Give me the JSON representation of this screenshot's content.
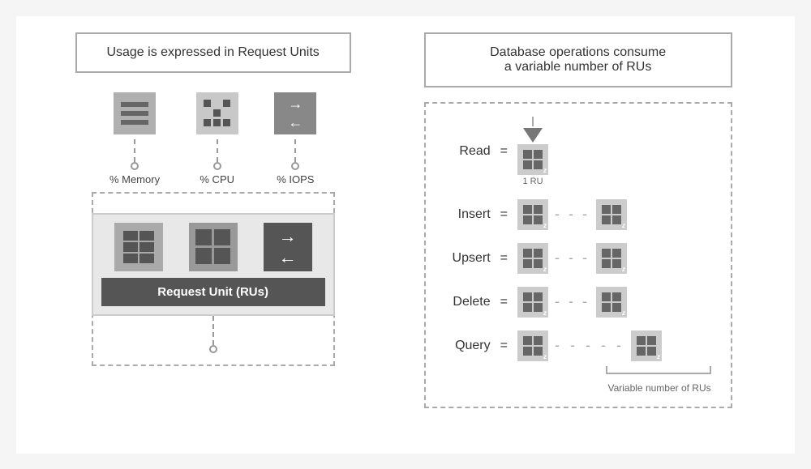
{
  "left_panel": {
    "title": "Usage is expressed in Request Units",
    "resources": [
      {
        "label": "% Memory",
        "type": "memory"
      },
      {
        "label": "% CPU",
        "type": "cpu"
      },
      {
        "label": "% IOPS",
        "type": "iops"
      }
    ],
    "ru_label": "Request Unit (RUs)"
  },
  "right_panel": {
    "title": "Database operations consume\na variable number of RUs",
    "operations": [
      {
        "name": "Read",
        "ru": "1 RU",
        "multi": false
      },
      {
        "name": "Insert",
        "ru": "",
        "multi": true
      },
      {
        "name": "Upsert",
        "ru": "",
        "multi": true
      },
      {
        "name": "Delete",
        "ru": "",
        "multi": true
      },
      {
        "name": "Query",
        "ru": "",
        "multi": true
      }
    ],
    "variable_label": "Variable number of RUs"
  }
}
